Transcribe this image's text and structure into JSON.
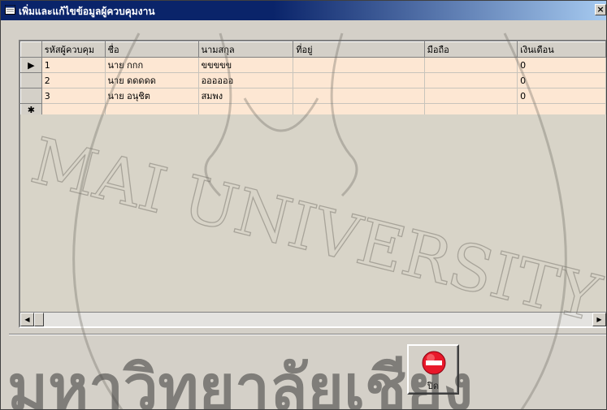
{
  "window": {
    "title": "เพิ่มและแก้ไขข้อมูลผู้ควบคุมงาน",
    "close_glyph": "×",
    "icon": "form-icon"
  },
  "grid": {
    "columns": [
      "รหัสผู้ควบคุม",
      "ชื่อ",
      "นามสกุล",
      "ที่อยู่",
      "มือถือ",
      "เงินเดือน"
    ],
    "rows": [
      [
        "1",
        "นาย กกก",
        "ขขขขข",
        "",
        "",
        "0"
      ],
      [
        "2",
        "นาย ดดดดด",
        "ออออออ",
        "",
        "",
        "0"
      ],
      [
        "3",
        "นาย อนุชิต",
        "สมพง",
        "",
        "",
        "0"
      ]
    ],
    "current_row_marker": "▶",
    "new_row_marker": "✱",
    "cell_color": "#fde7d3",
    "scroll_left_glyph": "◀",
    "scroll_right_glyph": "▶"
  },
  "close_button": {
    "label": "ปิด",
    "icon": "no-entry-icon",
    "icon_color": "#e8182a"
  },
  "watermark": {
    "line1": "MAI UNIVERSITY",
    "line2": "มหาวิทยาลัยเชียง"
  }
}
